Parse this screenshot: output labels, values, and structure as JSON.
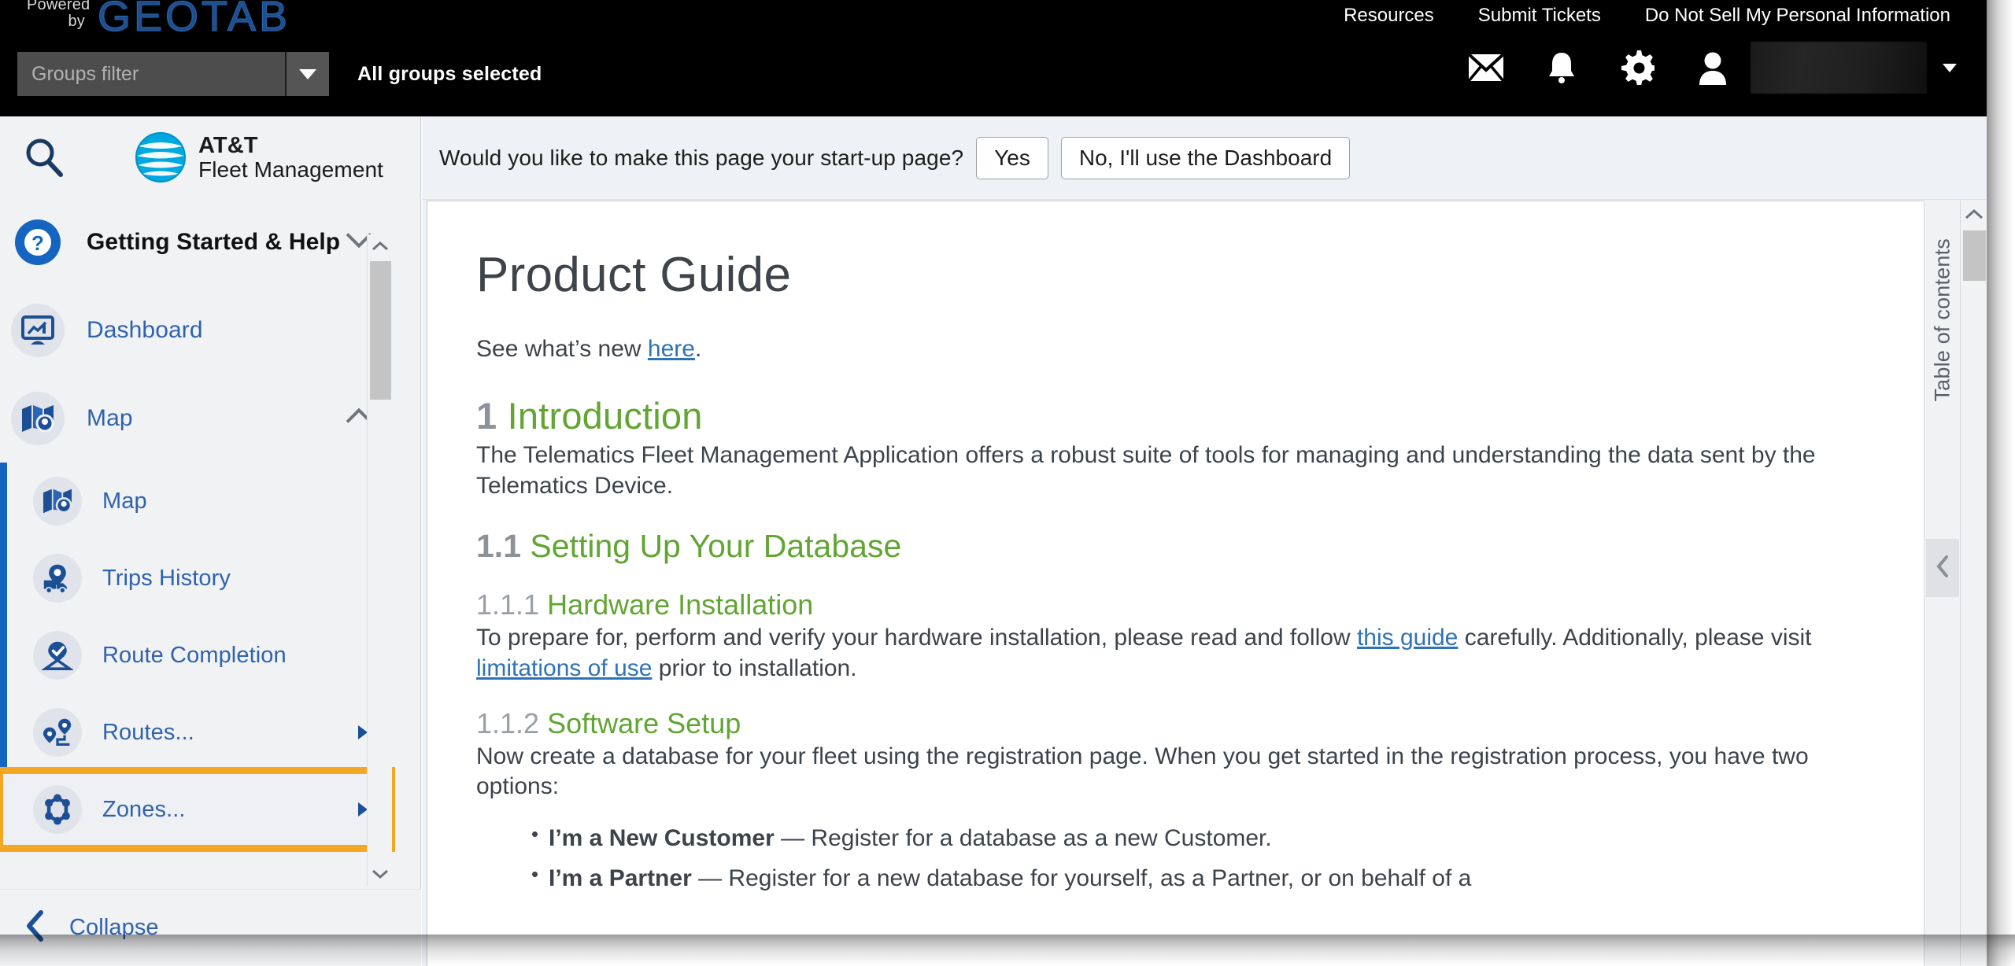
{
  "header": {
    "powered_by": "Powered\nby",
    "brand_logo": "GEOTAB",
    "powered_line1": "Powered",
    "powered_line2": "by",
    "links": [
      {
        "label": "Resources"
      },
      {
        "label": "Submit Tickets"
      },
      {
        "label": "Do Not Sell My Personal Information"
      }
    ],
    "groups_filter_placeholder": "Groups filter",
    "groups_filter_value": "",
    "groups_selected_text": "All groups selected",
    "icons": [
      {
        "name": "mail-icon"
      },
      {
        "name": "bell-icon"
      },
      {
        "name": "gear-icon"
      },
      {
        "name": "user-icon"
      }
    ],
    "user_name": "",
    "accent_blue": "#1e4f8c"
  },
  "sidebar": {
    "search_icon": "search-icon",
    "brand_line1": "AT&T",
    "brand_line2": "Fleet Management",
    "items": [
      {
        "label": "Getting Started & Help",
        "icon": "help-circle-icon",
        "chevron": "chevron-down"
      },
      {
        "label": "Dashboard",
        "icon": "dashboard-icon"
      },
      {
        "label": "Map",
        "icon": "map-pin-icon",
        "chevron": "chevron-up"
      }
    ],
    "submenu": [
      {
        "label": "Map",
        "icon": "map-pin-icon"
      },
      {
        "label": "Trips History",
        "icon": "trips-history-icon"
      },
      {
        "label": "Route Completion",
        "icon": "route-completion-icon"
      },
      {
        "label": "Routes...",
        "icon": "routes-icon",
        "has_arrow": true
      },
      {
        "label": "Zones...",
        "icon": "zones-icon",
        "has_arrow": true,
        "highlighted": true
      }
    ],
    "collapse_label": "Collapse",
    "collapse_icon": "chevron-left-icon",
    "highlight_color": "#f5a623",
    "accent_color": "#1565c0"
  },
  "banner": {
    "question": "Would you like to make this page your start-up page?",
    "yes_label": "Yes",
    "no_label": "No, I'll use the Dashboard"
  },
  "document": {
    "title": "Product Guide",
    "intro_prefix": "See what’s new ",
    "intro_link": "here",
    "intro_suffix": ".",
    "s1_num": "1",
    "s1_title": "Introduction",
    "s1_body": "The Telematics Fleet Management Application offers a robust suite of tools for managing and understanding the data sent by the Telematics Device.",
    "s11_num": "1.1",
    "s11_title": "Setting Up Your Database",
    "s111_num": "1.1.1",
    "s111_title": "Hardware Installation",
    "s111_p1": "To prepare for, perform and verify your hardware installation, please read and follow ",
    "s111_link1": "this guide",
    "s111_p2": " carefully. Additionally, please visit ",
    "s111_link2": "limitations of use",
    "s111_p3": " prior to installation.",
    "s112_num": "1.1.2",
    "s112_title": "Software Setup",
    "s112_body": "Now create a database for your fleet using the registration page. When you get started in the registration process, you have two options:",
    "bullets": [
      {
        "bold": "I’m a New Customer",
        "rest": " — Register for a database as a new Customer."
      },
      {
        "bold": "I’m a Partner",
        "rest": " — Register for a new database for yourself, as a Partner, or on behalf of a"
      }
    ],
    "heading_color": "#61a532",
    "link_color": "#2f72b8"
  },
  "toc": {
    "label": "Table of contents",
    "collapse_icon": "chevron-left-icon"
  },
  "scrollbars": {
    "up_icon": "chevron-up-icon",
    "down_icon": "chevron-down-icon"
  }
}
